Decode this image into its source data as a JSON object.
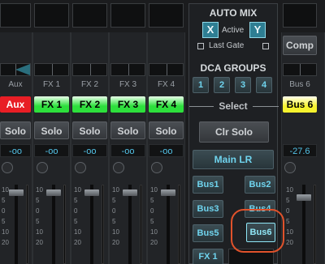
{
  "channels": [
    {
      "name": "Aux",
      "lcd": "Aux",
      "lcd_bg": "#e81e25",
      "lcd_fg": "#ffffff",
      "solo": "Solo",
      "level": "-oo"
    },
    {
      "name": "FX 1",
      "lcd": "FX 1",
      "lcd_bg": "#2de03c",
      "lcd_fg": "#000000",
      "solo": "Solo",
      "level": "-oo"
    },
    {
      "name": "FX 2",
      "lcd": "FX 2",
      "lcd_bg": "#2de03c",
      "lcd_fg": "#000000",
      "solo": "Solo",
      "level": "-oo"
    },
    {
      "name": "FX 3",
      "lcd": "FX 3",
      "lcd_bg": "#2de03c",
      "lcd_fg": "#000000",
      "solo": "Solo",
      "level": "-oo"
    },
    {
      "name": "FX 4",
      "lcd": "FX 4",
      "lcd_bg": "#2de03c",
      "lcd_fg": "#000000",
      "solo": "Solo",
      "level": "-oo"
    }
  ],
  "bus6": {
    "comp": "Comp",
    "name": "Bus 6",
    "lcd": "Bus 6",
    "lcd_bg": "#f6f22e",
    "lcd_fg": "#000000",
    "level": "-27.6"
  },
  "scale_labels": [
    "10",
    "5",
    "0",
    "5",
    "10",
    "20"
  ],
  "automix": {
    "title": "AUTO MIX",
    "x_label": "X",
    "active_label": "Active",
    "y_label": "Y",
    "last_gate_label": "Last Gate"
  },
  "dca": {
    "title": "DCA GROUPS",
    "buttons": [
      "1",
      "2",
      "3",
      "4"
    ]
  },
  "select_label": "Select",
  "clr_solo": "Clr Solo",
  "main_lr": "Main LR",
  "bus_buttons": {
    "bus1": "Bus1",
    "bus2": "Bus2",
    "bus3": "Bus3",
    "bus4": "Bus4",
    "bus5": "Bus5",
    "bus6": "Bus6",
    "fx1": "FX 1"
  }
}
